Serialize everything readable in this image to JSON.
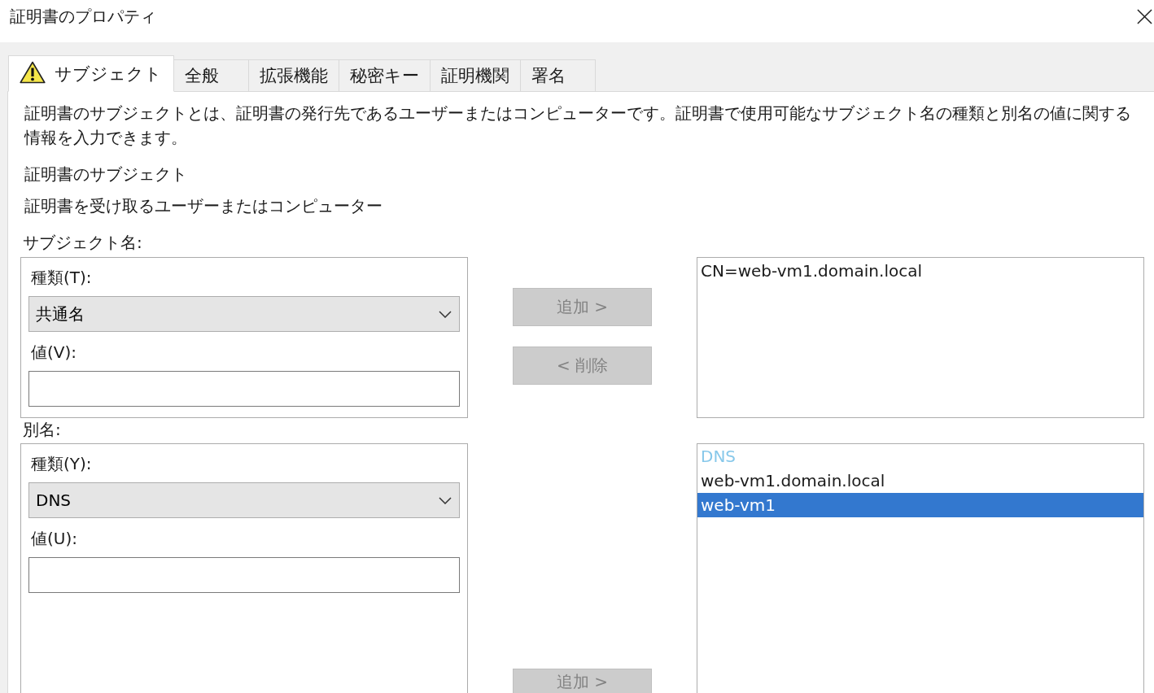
{
  "window": {
    "title": "証明書のプロパティ"
  },
  "tabs": [
    {
      "label": "サブジェクト",
      "selected": true,
      "warning": true
    },
    {
      "label": "全般",
      "selected": false,
      "warning": false
    },
    {
      "label": "拡張機能",
      "selected": false,
      "warning": false
    },
    {
      "label": "秘密キー",
      "selected": false,
      "warning": false
    },
    {
      "label": "証明機関",
      "selected": false,
      "warning": false
    },
    {
      "label": "署名",
      "selected": false,
      "warning": false
    }
  ],
  "subject_tab": {
    "description": "証明書のサブジェクトとは、証明書の発行先であるユーザーまたはコンピューターです。証明書で使用可能なサブジェクト名の種類と別名の値に関する情報を入力できます。",
    "heading": "証明書のサブジェクト",
    "subheading": "証明書を受け取るユーザーまたはコンピューター",
    "sections": [
      {
        "label": "サブジェクト名:",
        "type_label": "種類(T):",
        "type": "共通名",
        "value_label": "値(V):",
        "buttons": [
          {
            "label": "追加 >",
            "disabled": true
          },
          {
            "label": "< 削除",
            "disabled": true
          }
        ],
        "list": [
          {
            "kind": "item",
            "text": "CN=web-vm1.domain.local",
            "selected": false
          }
        ]
      },
      {
        "label": "別名:",
        "type_label": "種類(Y):",
        "type": "DNS",
        "value_label": "値(U):",
        "buttons": [
          {
            "label": "追加 >",
            "disabled": true
          }
        ],
        "list": [
          {
            "kind": "group",
            "text": "DNS",
            "selected": false
          },
          {
            "kind": "item",
            "text": "web-vm1.domain.local",
            "selected": false
          },
          {
            "kind": "item",
            "text": "web-vm1",
            "selected": true
          }
        ]
      }
    ]
  }
}
